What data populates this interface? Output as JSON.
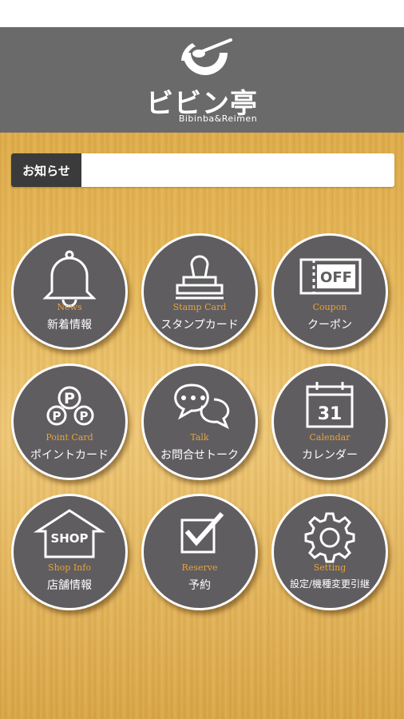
{
  "header": {
    "logo_title": "ビビン亭",
    "logo_subtitle": "Bibinba&Reimen"
  },
  "news": {
    "label": "お知らせ",
    "content": ""
  },
  "menu": [
    {
      "en": "News",
      "jp": "新着情報",
      "icon": "bell-icon"
    },
    {
      "en": "Stamp Card",
      "jp": "スタンプカード",
      "icon": "stamp-icon"
    },
    {
      "en": "Coupon",
      "jp": "クーポン",
      "icon": "coupon-icon",
      "icon_text": "OFF"
    },
    {
      "en": "Point Card",
      "jp": "ポイントカード",
      "icon": "points-icon",
      "icon_text": "P"
    },
    {
      "en": "Talk",
      "jp": "お問合せトーク",
      "icon": "chat-bubbles-icon"
    },
    {
      "en": "Calendar",
      "jp": "カレンダー",
      "icon": "calendar-icon",
      "icon_text": "31"
    },
    {
      "en": "Shop Info",
      "jp": "店舗情報",
      "icon": "shop-icon",
      "icon_text": "SHOP"
    },
    {
      "en": "Reserve",
      "jp": "予約",
      "icon": "checkbox-icon"
    },
    {
      "en": "Setting",
      "jp": "設定/機種変更引継",
      "icon": "gear-icon"
    }
  ],
  "colors": {
    "header_bg": "#6b6a6b",
    "tile_bg": "#5f5d5f",
    "accent_label": "#e9a23a"
  }
}
